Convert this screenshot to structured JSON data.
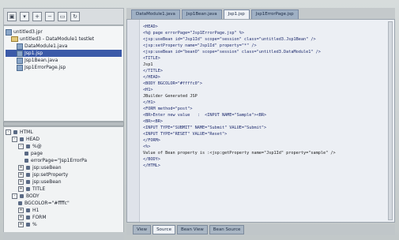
{
  "project_tree": {
    "items": [
      {
        "label": "untitled3.jpr",
        "indent": 0,
        "icon": "project-icon",
        "selected": false
      },
      {
        "label": "untitled3 - DataModule1 testlet",
        "indent": 1,
        "icon": "folder-icon",
        "selected": false
      },
      {
        "label": "DataModule1.java",
        "indent": 2,
        "icon": "java-file-icon",
        "selected": false
      },
      {
        "label": "Jsp1.jsp",
        "indent": 2,
        "icon": "jsp-file-icon",
        "selected": true
      },
      {
        "label": "Jsp1Bean.java",
        "indent": 2,
        "icon": "java-file-icon",
        "selected": false
      },
      {
        "label": "Jsp1ErrorPage.jsp",
        "indent": 2,
        "icon": "jsp-file-icon",
        "selected": false
      }
    ]
  },
  "structure_tree": {
    "items": [
      {
        "label": "HTML",
        "indent": 0,
        "exp": "-"
      },
      {
        "label": "HEAD",
        "indent": 1,
        "exp": "-"
      },
      {
        "label": "%@",
        "indent": 2,
        "exp": "-"
      },
      {
        "label": "page",
        "indent": 3,
        "exp": ""
      },
      {
        "label": "errorPage=\"Jsp1ErrorPa",
        "indent": 3,
        "exp": ""
      },
      {
        "label": "jsp:useBean",
        "indent": 2,
        "exp": "+"
      },
      {
        "label": "jsp:setProperty",
        "indent": 2,
        "exp": "+"
      },
      {
        "label": "jsp:useBean",
        "indent": 2,
        "exp": "+"
      },
      {
        "label": "TITLE",
        "indent": 2,
        "exp": "+"
      },
      {
        "label": "BODY",
        "indent": 1,
        "exp": "-"
      },
      {
        "label": "BGCOLOR=\"#ffffc\"",
        "indent": 2,
        "exp": ""
      },
      {
        "label": "H1",
        "indent": 2,
        "exp": "+"
      },
      {
        "label": "FORM",
        "indent": 2,
        "exp": "+"
      },
      {
        "label": "%",
        "indent": 2,
        "exp": "+"
      }
    ]
  },
  "editor_tabs": [
    {
      "label": "DataModule1.java",
      "active": false
    },
    {
      "label": "Jsp1Bean.java",
      "active": false
    },
    {
      "label": "Jsp1.jsp",
      "active": true
    },
    {
      "label": "Jsp1ErrorPage.jsp",
      "active": false
    }
  ],
  "code_lines": [
    "<HEAD>",
    "<%@ page errorPage=\"Jsp1ErrorPage.jsp\" %>",
    "<jsp:useBean id=\"Jsp1Id\" scope=\"session\" class=\"untitled3.Jsp1Bean\" />",
    "<jsp:setProperty name=\"Jsp1Id\" property=\"*\" />",
    "<jsp:useBean id=\"beanO\" scope=\"session\" class=\"untitled3.DataModule1\" />",
    "<TITLE>",
    "Jsp1",
    "</TITLE>",
    "</HEAD>",
    "<BODY BGCOLOR=\"#ffffc0\">",
    "<H1>",
    "JBuilder Generated JSP",
    "</H1>",
    "<FORM method=\"post\">",
    "<BR>Enter new value   :  <INPUT NAME=\"Sample\"><BR>",
    "<BR><BR>",
    "<INPUT TYPE=\"SUBMIT\" NAME=\"Submit\" VALUE=\"Submit\">",
    "<INPUT TYPE=\"RESET\" VALUE=\"Reset\">",
    "</FORM>",
    "<%>",
    "Value of Bean property is :<jsp:getProperty name=\"Jsp1Id\" property=\"sample\" />",
    "</BODY>",
    "</HTML>"
  ],
  "bottom_tabs": [
    {
      "label": "View",
      "active": false
    },
    {
      "label": "Source",
      "active": true
    },
    {
      "label": "Bean View",
      "active": false
    },
    {
      "label": "Bean Source",
      "active": false
    }
  ]
}
